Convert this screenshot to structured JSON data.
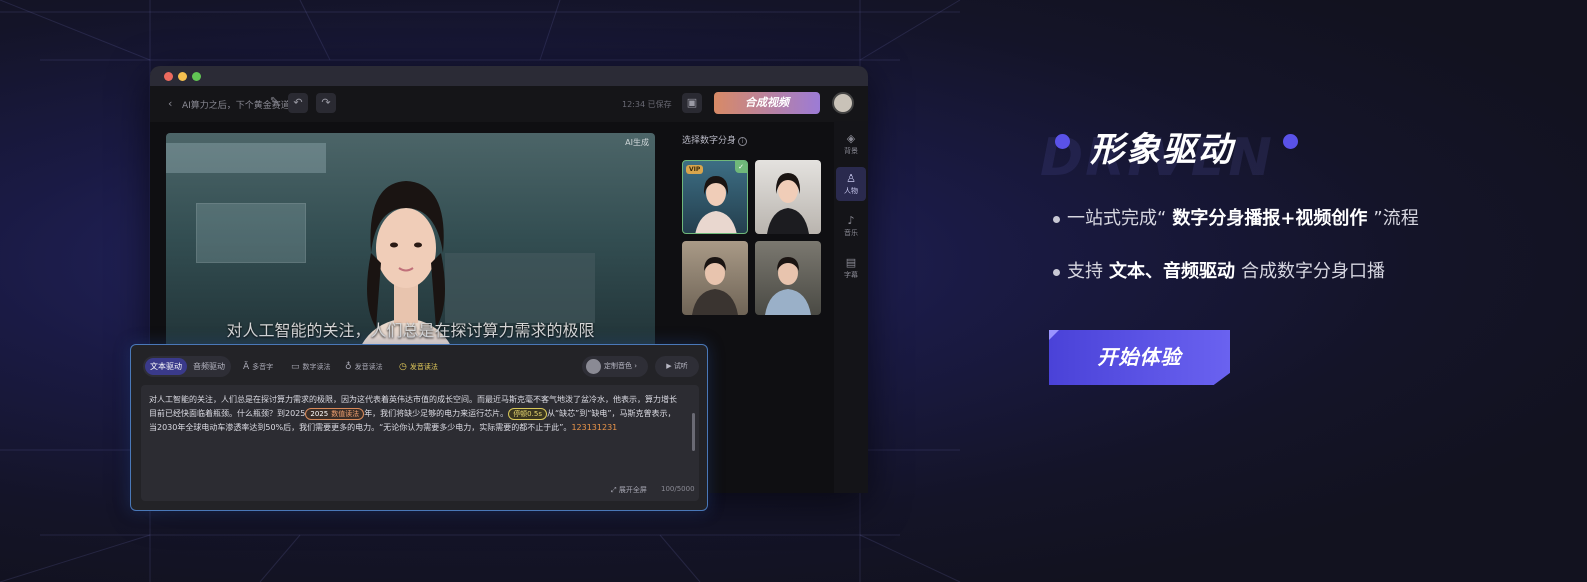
{
  "window": {
    "project_title": "AI算力之后，下个黄金赛道",
    "save_status": "12:34 已保存",
    "compose_label": "合成视频"
  },
  "preview": {
    "ai_tag": "AI生成",
    "subtitle": "对人工智能的关注，人们总是在探讨算力需求的极限"
  },
  "picker": {
    "title": "选择数字分身",
    "vip_badge": "VIP"
  },
  "sidebar": {
    "items": [
      {
        "label": "背景",
        "icon": "paint-bucket-icon"
      },
      {
        "label": "人物",
        "icon": "person-icon"
      },
      {
        "label": "音乐",
        "icon": "music-note-icon"
      },
      {
        "label": "字幕",
        "icon": "subtitle-icon"
      }
    ]
  },
  "editor": {
    "tabs": [
      "文本驱动",
      "音频驱动"
    ],
    "tools": [
      "多音字",
      "数字读法",
      "发音读法",
      "发音读法"
    ],
    "voice_label": "定制音色",
    "listen_label": "试听",
    "text_part1": "对人工智能的关注，人们总是在探讨算力需求的极限，因为这代表着英伟达市值的成长空间。而最近马斯克毫不客气地泼了盆冷水，他表示，算力增长目前已经快面临着瓶颈。什么瓶颈？到2025",
    "num_pill_value": "2025",
    "num_pill_label": "数值读法",
    "text_part2": "年，我们将缺少足够的电力来运行芯片。",
    "pause_pill": "停顿0.5s",
    "text_part3": "从“缺芯”到“缺电”，马斯克曾表示，当2030年全球电动车渗透率达到50%后，我们需要更多的电力。“无论你认为需要多少电力，实际需要的都不止于此”。",
    "text_highlight": "123131231",
    "expand_label": "展开全屏",
    "char_count": "100/5000"
  },
  "feature": {
    "ghost_text": "DRIVEN",
    "title": "形象驱动",
    "bullet1_prefix": "一站式完成“",
    "bullet1_em": "数字分身播报+视频创作",
    "bullet1_suffix": "”流程",
    "bullet2_prefix": "支持",
    "bullet2_em": "文本、音频驱动",
    "bullet2_suffix": "合成数字分身口播",
    "cta_label": "开始体验"
  },
  "colors": {
    "accent": "#5248e0",
    "compose_gradient_start": "#d88a66",
    "compose_gradient_end": "#9c7bd6",
    "editor_border": "#4a78b8"
  }
}
